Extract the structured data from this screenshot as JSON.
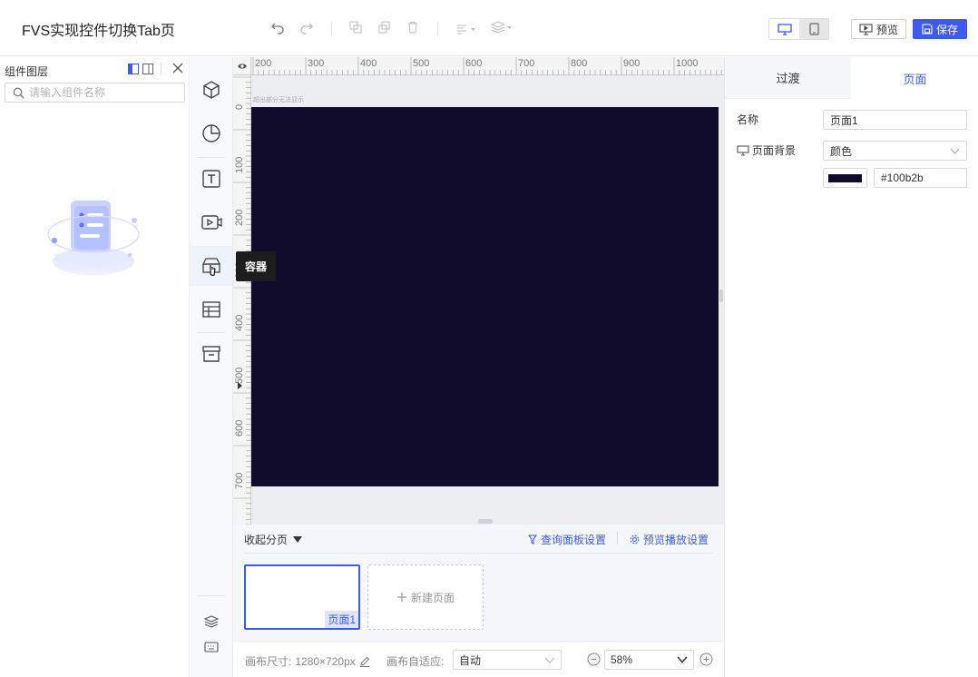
{
  "app": {
    "title": "FVS实现控件切换Tab页"
  },
  "toolbar": {
    "undo_icon": "undo-icon",
    "redo_icon": "redo-icon",
    "preview_label": "预览",
    "save_label": "保存"
  },
  "layer_panel": {
    "title": "组件图层",
    "search_placeholder": "请输入组件名称"
  },
  "rail": {
    "items": [
      "cube-icon",
      "pie-chart-icon",
      "text-icon",
      "video-icon",
      "container-icon",
      "table-icon",
      "archive-icon"
    ],
    "tooltip": "容器"
  },
  "canvas": {
    "ruler_top": [
      "200",
      "300",
      "400",
      "500",
      "600",
      "700",
      "800",
      "900",
      "1000"
    ],
    "ruler_left": [
      "0",
      "100",
      "200",
      "300",
      "400",
      "500",
      "600",
      "700"
    ],
    "hint": "超出部分无法显示",
    "background_color": "#100b2b"
  },
  "page_strip": {
    "collapse_label": "收起分页",
    "query_panel_label": "查询面板设置",
    "preview_play_label": "预览播放设置",
    "pages": [
      {
        "label": "页面1"
      }
    ],
    "new_page_label": "新建页面"
  },
  "bottom_bar": {
    "canvas_size_label": "画布尺寸:",
    "canvas_size_value": "1280×720px",
    "adapt_label": "画布自适应:",
    "adapt_value": "自动",
    "zoom_value": "58%"
  },
  "properties": {
    "tabs": [
      "过渡",
      "页面"
    ],
    "active_tab": "页面",
    "name_label": "名称",
    "name_value": "页面1",
    "bg_label": "页面背景",
    "bg_type": "颜色",
    "bg_color": "#100b2b"
  },
  "colors": {
    "accent": "#3d5af1"
  }
}
